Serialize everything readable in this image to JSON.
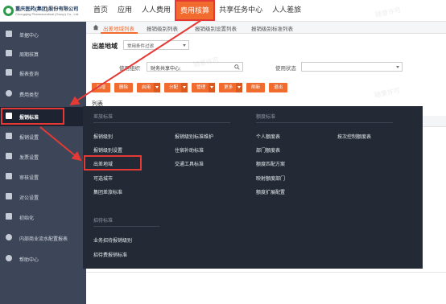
{
  "header": {
    "logo_name": "重庆医药(集团)股份有限公司",
    "logo_sub": "Chongqing Pharmaceutical (Group) Co., Ltd.",
    "nav": [
      "首页",
      "应用",
      "人人费用",
      "费用核算",
      "共享任务中心",
      "人人差旅"
    ]
  },
  "sidebar": {
    "items": [
      "单据中心",
      "周期核算",
      "报表查询",
      "费用类型",
      "报销标准",
      "报销设置",
      "发票设置",
      "审核设置",
      "对公设置",
      "初始化",
      "内部商业流水配置报表",
      "帮助中心"
    ]
  },
  "tabs": [
    "出差地域列表",
    "报销级别列表",
    "报销级别设置列表",
    "报销级别标准列表"
  ],
  "main": {
    "title": "出差地域",
    "standard_select": "常用条件过滤",
    "org_label": "使用组织",
    "org_value": "财务共享中心;",
    "status_label": "使用状态",
    "status_value": "",
    "buttons": [
      "新增",
      "删除",
      "启用",
      "分配",
      "管理",
      "更多",
      "刷新",
      "退出"
    ],
    "list_title": "列表"
  },
  "mega_menu": {
    "left_section": "差旅标准",
    "left_col1": [
      "报销级别",
      "报销级别设置",
      "出差地域",
      "可选城市",
      "集团差旅标准"
    ],
    "left_col2": [
      "报销级别标准维护",
      "住宿补助标准",
      "交通工具标准"
    ],
    "bottom_section": "招待标准",
    "bottom_items": [
      "业务招待报销级别",
      "招待费报销标准"
    ],
    "right_section": "额度标准",
    "right_col1": [
      "个人额度表",
      "部门额度表",
      "额度匹配方案",
      "映射额度部门",
      "额度扩展配置"
    ],
    "right_col2": [
      "按次控制额度表"
    ]
  },
  "watermark": "随意许可",
  "colors": {
    "accent": "#f26b2e",
    "sidebar": "#3c4658",
    "menu": "#242a35",
    "highlight_box": "#e53935"
  }
}
